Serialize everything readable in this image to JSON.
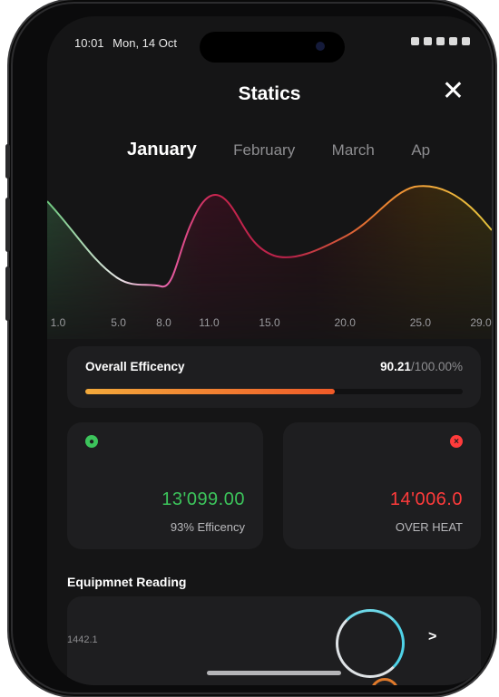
{
  "status_bar": {
    "time": "10:01",
    "date": "Mon, 14 Oct"
  },
  "header": {
    "title": "Statics",
    "close_glyph": "✕"
  },
  "months": [
    "January",
    "February",
    "March",
    "Ap"
  ],
  "active_month_index": 0,
  "chart_data": {
    "type": "area",
    "x": [
      1.0,
      5.0,
      8.0,
      11.0,
      15.0,
      20.0,
      25.0,
      29.0
    ],
    "x_tick_labels": [
      "1.0",
      "5.0",
      "8.0",
      "11.0",
      "15.0",
      "20.0",
      "25.0",
      "29.0"
    ],
    "gradient_colors": [
      "#6cc77c",
      "#e8e8e8",
      "#e85fa8",
      "#c8244d",
      "#b8234a",
      "#e87b2e",
      "#f2a93b",
      "#e2c13c"
    ]
  },
  "efficiency": {
    "label": "Overall Efficency",
    "value": "90.21",
    "total": "/100.00%",
    "progress_percent": 66
  },
  "stats": [
    {
      "icon": "shield-icon",
      "color": "#3cc45b",
      "value": "13'099.00",
      "sub": "93% Efficency"
    },
    {
      "icon": "x-circle-icon",
      "color": "#ff3b3b",
      "value": "14'006.0",
      "sub": "OVER HEAT"
    }
  ],
  "section_title": "Equipmnet Reading",
  "reading": {
    "value": "1442.1",
    "chevron": ">"
  }
}
